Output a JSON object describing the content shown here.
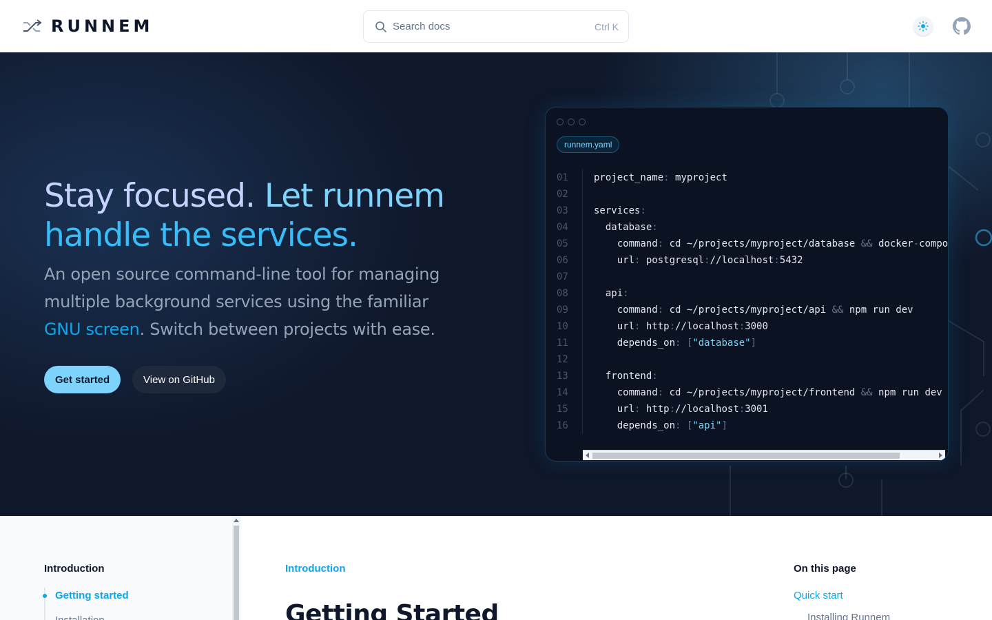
{
  "header": {
    "logo_text": "RUNNEM",
    "search_placeholder": "Search docs",
    "search_shortcut": "Ctrl K"
  },
  "hero": {
    "title_part1": "Stay focused.",
    "title_part2": "Let runnem",
    "title_part3": "handle the services.",
    "desc_part1": "An open source command-line tool for managing multiple background services using the familiar",
    "desc_link": "GNU screen",
    "desc_part2": ". Switch between projects with ease.",
    "primary_button": "Get started",
    "secondary_button": "View on GitHub"
  },
  "code": {
    "filename": "runnem.yaml",
    "line_numbers": [
      "01",
      "02",
      "03",
      "04",
      "05",
      "06",
      "07",
      "08",
      "09",
      "10",
      "11",
      "12",
      "13",
      "14",
      "15",
      "16"
    ],
    "lines": [
      [
        {
          "t": "project_name"
        },
        {
          "t": ":",
          "c": "p"
        },
        {
          "t": " myproject"
        }
      ],
      [],
      [
        {
          "t": "services"
        },
        {
          "t": ":",
          "c": "p"
        }
      ],
      [
        {
          "t": "  database"
        },
        {
          "t": ":",
          "c": "p"
        }
      ],
      [
        {
          "t": "    command"
        },
        {
          "t": ":",
          "c": "p"
        },
        {
          "t": " cd ~/projects/myproject/database "
        },
        {
          "t": "&&",
          "c": "p"
        },
        {
          "t": " docker"
        },
        {
          "t": "-",
          "c": "p"
        },
        {
          "t": "compose up"
        }
      ],
      [
        {
          "t": "    url"
        },
        {
          "t": ":",
          "c": "p"
        },
        {
          "t": " postgresql"
        },
        {
          "t": ":",
          "c": "p"
        },
        {
          "t": "//localhost"
        },
        {
          "t": ":",
          "c": "p"
        },
        {
          "t": "5432"
        }
      ],
      [],
      [
        {
          "t": "  api"
        },
        {
          "t": ":",
          "c": "p"
        }
      ],
      [
        {
          "t": "    command"
        },
        {
          "t": ":",
          "c": "p"
        },
        {
          "t": " cd ~/projects/myproject/api "
        },
        {
          "t": "&&",
          "c": "p"
        },
        {
          "t": " npm run dev"
        }
      ],
      [
        {
          "t": "    url"
        },
        {
          "t": ":",
          "c": "p"
        },
        {
          "t": " http"
        },
        {
          "t": ":",
          "c": "p"
        },
        {
          "t": "//localhost"
        },
        {
          "t": ":",
          "c": "p"
        },
        {
          "t": "3000"
        }
      ],
      [
        {
          "t": "    depends_on"
        },
        {
          "t": ":",
          "c": "p"
        },
        {
          "t": " "
        },
        {
          "t": "[",
          "c": "p"
        },
        {
          "t": "\"database\"",
          "c": "s"
        },
        {
          "t": "]",
          "c": "p"
        }
      ],
      [],
      [
        {
          "t": "  frontend"
        },
        {
          "t": ":",
          "c": "p"
        }
      ],
      [
        {
          "t": "    command"
        },
        {
          "t": ":",
          "c": "p"
        },
        {
          "t": " cd ~/projects/myproject/frontend "
        },
        {
          "t": "&&",
          "c": "p"
        },
        {
          "t": " npm run dev"
        }
      ],
      [
        {
          "t": "    url"
        },
        {
          "t": ":",
          "c": "p"
        },
        {
          "t": " http"
        },
        {
          "t": ":",
          "c": "p"
        },
        {
          "t": "//localhost"
        },
        {
          "t": ":",
          "c": "p"
        },
        {
          "t": "3001"
        }
      ],
      [
        {
          "t": "    depends_on"
        },
        {
          "t": ":",
          "c": "p"
        },
        {
          "t": " "
        },
        {
          "t": "[",
          "c": "p"
        },
        {
          "t": "\"api\"",
          "c": "s"
        },
        {
          "t": "]",
          "c": "p"
        }
      ]
    ]
  },
  "sidebar": {
    "heading": "Introduction",
    "active_item": "Getting started",
    "next_item": "Installation"
  },
  "main": {
    "breadcrumb": "Introduction",
    "title": "Getting Started"
  },
  "toc": {
    "heading": "On this page",
    "items": [
      "Quick start",
      "Installing Runnem"
    ]
  },
  "colors": {
    "accent": "#0ea5e9",
    "hero_bg": "#0f172a",
    "primary_button_bg": "#7dd3fc"
  }
}
